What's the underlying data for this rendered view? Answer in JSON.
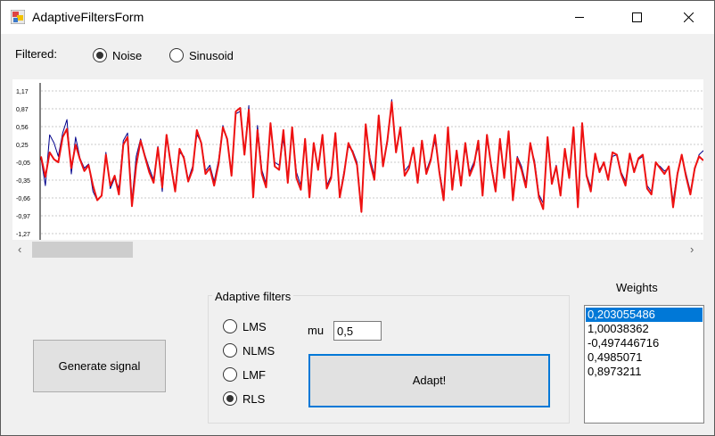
{
  "window": {
    "title": "AdaptiveFiltersForm",
    "icon": "windows-forms-app-icon",
    "controls": [
      "minimize-icon",
      "maximize-icon",
      "close-icon"
    ]
  },
  "filtered": {
    "label": "Filtered:",
    "options": [
      {
        "label": "Noise",
        "checked": true
      },
      {
        "label": "Sinusoid",
        "checked": false
      }
    ]
  },
  "chart_data": {
    "type": "line",
    "yticks": [
      "1,17",
      "0,87",
      "0,56",
      "0,25",
      "-0,05",
      "-0,35",
      "-0,66",
      "-0,97",
      "-1,27"
    ],
    "ylim": [
      -1.27,
      1.17
    ],
    "grid": true,
    "series": [
      {
        "color": "#00008b",
        "values": [
          0.02,
          -0.45,
          0.42,
          0.28,
          0.05,
          0.45,
          0.68,
          -0.25,
          0.38,
          0.02,
          -0.15,
          -0.08,
          -0.55,
          -0.7,
          -0.62,
          0.12,
          -0.5,
          -0.32,
          -0.5,
          0.32,
          0.45,
          -0.7,
          0.05,
          0.35,
          0.08,
          -0.15,
          -0.35,
          0.22,
          -0.55,
          0.35,
          -0.05,
          -0.52,
          0.12,
          0.05,
          -0.35,
          -0.12,
          0.42,
          0.3,
          -0.2,
          -0.1,
          -0.38,
          -0.02,
          0.58,
          0.32,
          -0.22,
          0.78,
          0.82,
          0.1,
          0.92,
          -0.6,
          0.58,
          -0.18,
          -0.42,
          0.55,
          -0.05,
          -0.1,
          0.35,
          -0.35,
          0.5,
          -0.22,
          -0.45,
          0.28,
          -0.58,
          0.22,
          -0.12,
          0.35,
          -0.45,
          -0.28,
          0.38,
          -0.62,
          -0.2,
          0.22,
          0.15,
          -0.05,
          -0.85,
          0.55,
          0.02,
          -0.28,
          0.72,
          -0.08,
          0.28,
          1.02,
          0.15,
          0.48,
          -0.2,
          -0.1,
          0.15,
          -0.35,
          0.28,
          -0.2,
          0.02,
          0.32,
          -0.18,
          -0.62,
          0.48,
          -0.45,
          0.1,
          -0.38,
          0.2,
          -0.22,
          -0.05,
          0.22,
          -0.58,
          0.35,
          -0.08,
          -0.5,
          0.28,
          -0.25,
          0.42,
          -0.65,
          0.05,
          -0.12,
          -0.42,
          0.22,
          -0.02,
          -0.6,
          -0.75,
          0.28,
          -0.38,
          -0.1,
          -0.58,
          0.12,
          -0.3,
          0.45,
          -0.78,
          0.6,
          -0.25,
          -0.48,
          0.05,
          -0.18,
          -0.05,
          -0.32,
          0.05,
          0.08,
          -0.22,
          -0.38,
          0.05,
          -0.18,
          0.0,
          0.05,
          -0.45,
          -0.55,
          -0.08,
          -0.12,
          -0.2,
          -0.15,
          -0.72,
          -0.22,
          0.05,
          -0.25,
          -0.55,
          -0.18,
          0.08,
          0.15
        ]
      },
      {
        "color": "#ee1111",
        "values": [
          0.05,
          -0.3,
          0.12,
          0.0,
          -0.05,
          0.38,
          0.52,
          -0.15,
          0.25,
          0.0,
          -0.2,
          -0.1,
          -0.45,
          -0.7,
          -0.62,
          0.08,
          -0.45,
          -0.28,
          -0.6,
          0.25,
          0.38,
          -0.8,
          -0.1,
          0.32,
          0.05,
          -0.22,
          -0.4,
          0.2,
          -0.48,
          0.42,
          -0.1,
          -0.55,
          0.18,
          0.02,
          -0.38,
          -0.18,
          0.5,
          0.28,
          -0.25,
          -0.15,
          -0.45,
          -0.08,
          0.55,
          0.35,
          -0.28,
          0.82,
          0.88,
          0.08,
          0.85,
          -0.65,
          0.5,
          -0.25,
          -0.48,
          0.62,
          -0.12,
          -0.18,
          0.5,
          -0.4,
          0.55,
          -0.32,
          -0.52,
          0.35,
          -0.65,
          0.28,
          -0.18,
          0.42,
          -0.5,
          -0.32,
          0.45,
          -0.65,
          -0.25,
          0.28,
          0.12,
          -0.1,
          -0.9,
          0.6,
          -0.05,
          -0.35,
          0.75,
          -0.12,
          0.32,
          0.98,
          0.12,
          0.55,
          -0.28,
          -0.15,
          0.2,
          -0.4,
          0.32,
          -0.25,
          -0.02,
          0.42,
          -0.22,
          -0.7,
          0.55,
          -0.52,
          0.15,
          -0.45,
          0.28,
          -0.28,
          -0.1,
          0.32,
          -0.62,
          0.42,
          -0.12,
          -0.55,
          0.35,
          -0.32,
          0.48,
          -0.7,
          0.02,
          -0.18,
          -0.48,
          0.28,
          -0.08,
          -0.65,
          -0.85,
          0.38,
          -0.42,
          -0.12,
          -0.62,
          0.18,
          -0.32,
          0.55,
          -0.82,
          0.62,
          -0.28,
          -0.55,
          0.1,
          -0.22,
          -0.05,
          -0.35,
          0.12,
          0.08,
          -0.25,
          -0.45,
          0.1,
          -0.22,
          0.02,
          0.08,
          -0.5,
          -0.6,
          -0.05,
          -0.15,
          -0.25,
          -0.12,
          -0.82,
          -0.25,
          0.08,
          -0.3,
          -0.6,
          -0.15,
          0.05,
          -0.02
        ]
      }
    ]
  },
  "scrollbar": {
    "left_arrow": "‹",
    "right_arrow": "›",
    "position": 0.0
  },
  "generate_button": "Generate signal",
  "adaptive_filters": {
    "title": "Adaptive filters",
    "options": [
      {
        "label": "LMS",
        "checked": false
      },
      {
        "label": "NLMS",
        "checked": false
      },
      {
        "label": "LMF",
        "checked": false
      },
      {
        "label": "RLS",
        "checked": true
      }
    ],
    "mu_label": "mu",
    "mu_value": "0,5",
    "adapt_button": "Adapt!"
  },
  "weights": {
    "title": "Weights",
    "items": [
      "0,203055486",
      "1,00038362",
      "-0,497446716",
      "0,4985071",
      "0,8973211"
    ],
    "selected_index": 0
  }
}
